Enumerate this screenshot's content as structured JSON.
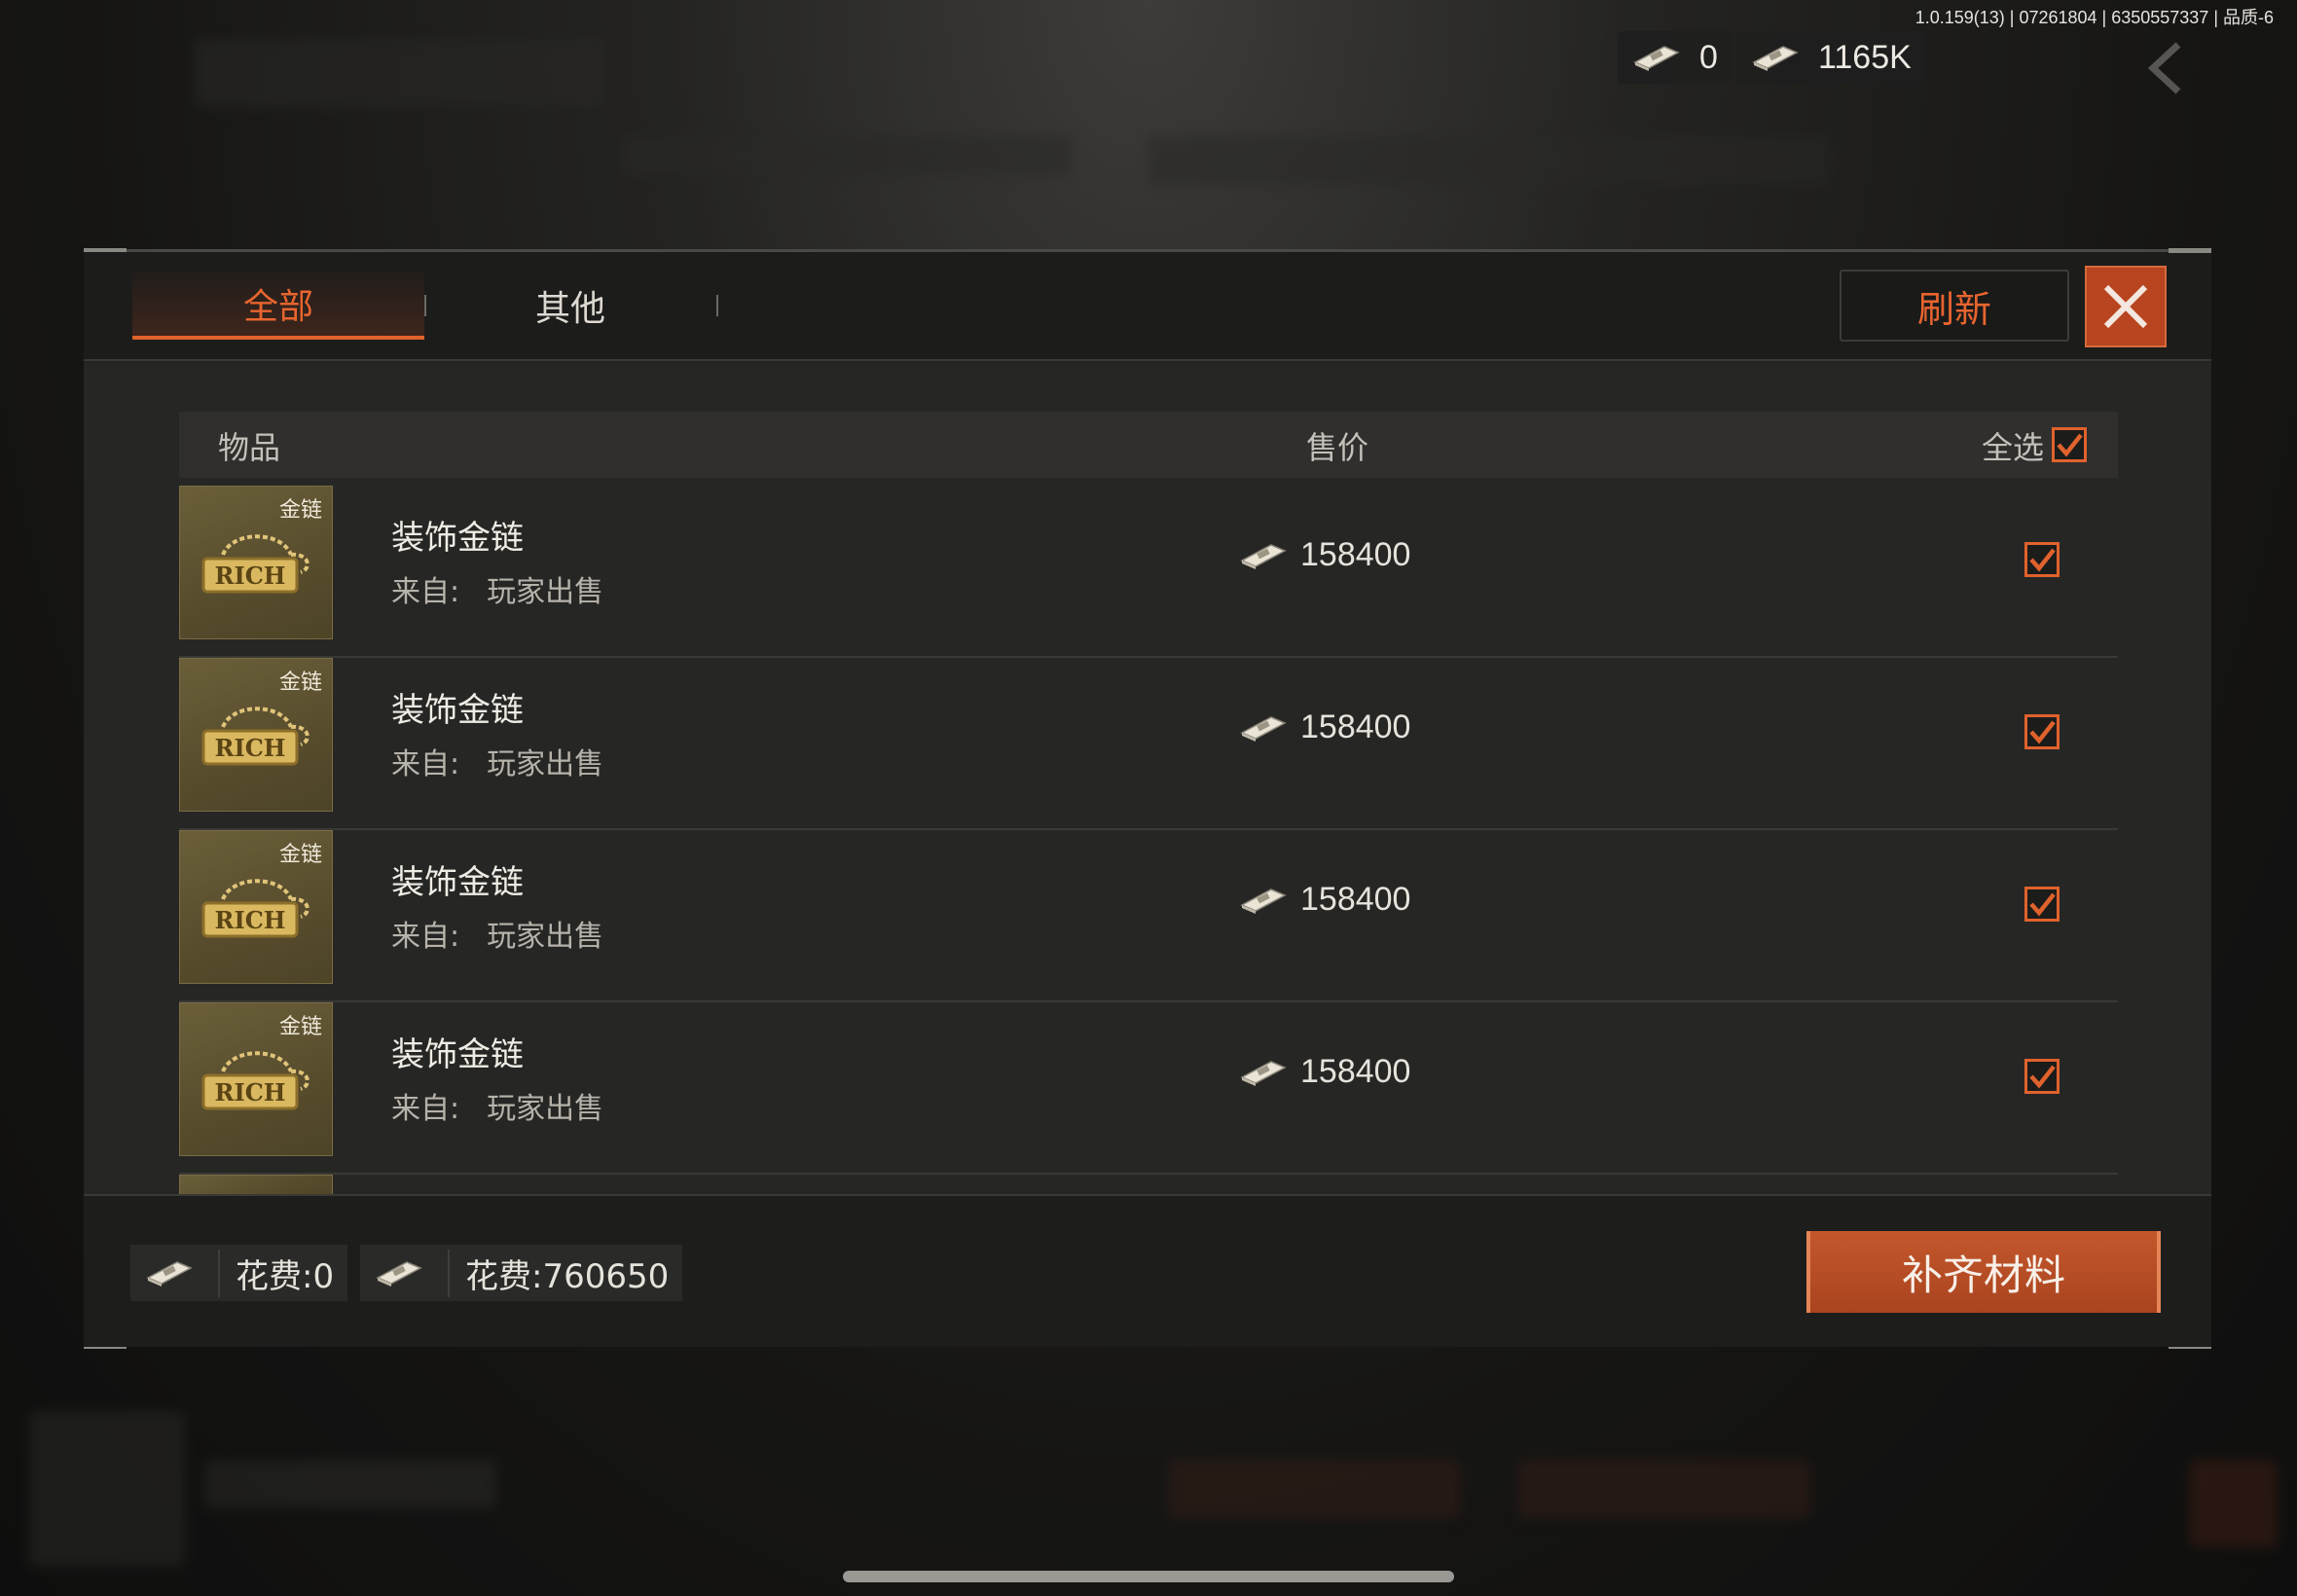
{
  "status": {
    "version_text": "1.0.159(13) | 07261804 | 6350557337 | 品质-6"
  },
  "top_currency": [
    {
      "icon": "cash-bundle-icon",
      "value": "0"
    },
    {
      "icon": "cash-bundle-icon",
      "value": "1165K"
    }
  ],
  "modal": {
    "tabs": [
      {
        "label": "全部",
        "active": true
      },
      {
        "label": "其他",
        "active": false
      }
    ],
    "refresh_label": "刷新",
    "close_icon": "close-icon",
    "header": {
      "item_col": "物品",
      "price_col": "售价",
      "select_all": "全选",
      "select_all_checked": true
    },
    "rows": [
      {
        "tag": "金链",
        "name": "装饰金链",
        "from_label": "来自:",
        "source": "玩家出售",
        "price": "158400",
        "checked": true
      },
      {
        "tag": "金链",
        "name": "装饰金链",
        "from_label": "来自:",
        "source": "玩家出售",
        "price": "158400",
        "checked": true
      },
      {
        "tag": "金链",
        "name": "装饰金链",
        "from_label": "来自:",
        "source": "玩家出售",
        "price": "158400",
        "checked": true
      },
      {
        "tag": "金链",
        "name": "装饰金链",
        "from_label": "来自:",
        "source": "玩家出售",
        "price": "158400",
        "checked": true
      }
    ],
    "footer": {
      "costs": [
        {
          "icon": "cash-bundle-icon",
          "label": "花费:0"
        },
        {
          "icon": "cash-bundle-icon",
          "label": "花费:760650"
        }
      ],
      "fill_button": "补齐材料"
    }
  },
  "colors": {
    "accent": "#e0622c",
    "button_fill": "#b8451f",
    "panel": "#232321"
  }
}
